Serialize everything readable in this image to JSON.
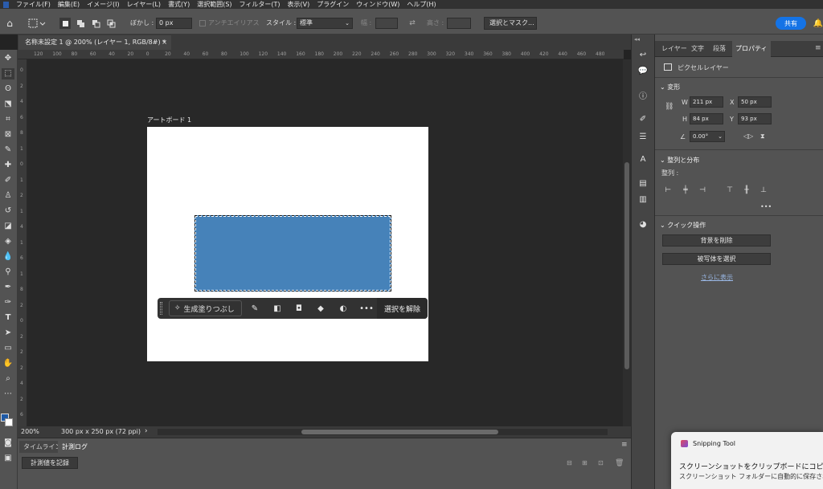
{
  "menubar": {
    "items": [
      "ファイル(F)",
      "編集(E)",
      "イメージ(I)",
      "レイヤー(L)",
      "書式(Y)",
      "選択範囲(S)",
      "フィルター(T)",
      "表示(V)",
      "プラグイン",
      "ウィンドウ(W)",
      "ヘルプ(H)"
    ]
  },
  "options": {
    "feather_label": "ぼかし :",
    "feather_value": "0 px",
    "antialias_label": "アンチエイリアス",
    "style_label": "スタイル :",
    "style_value": "標準",
    "width_label": "幅 :",
    "height_label": "高さ :",
    "select_mask_label": "選択とマスク...",
    "share_label": "共有"
  },
  "document": {
    "tab_title": "名称未設定 1 @ 200% (レイヤー 1, RGB/8#) *",
    "artboard_label": "アートボード 1",
    "zoom": "200%",
    "doc_info": "300 px x 250 px (72 ppi)"
  },
  "ruler": {
    "h_ticks": [
      "120",
      "100",
      "80",
      "60",
      "40",
      "20",
      "0",
      "20",
      "40",
      "60",
      "80",
      "100",
      "120",
      "140",
      "160",
      "180",
      "200",
      "220",
      "240",
      "260",
      "280",
      "300",
      "320",
      "340",
      "360",
      "380",
      "400",
      "420",
      "440",
      "460",
      "480"
    ],
    "v_ticks": [
      "0",
      "2",
      "4",
      "6",
      "8",
      "1",
      "0",
      "1",
      "2",
      "1",
      "4",
      "1",
      "6",
      "1",
      "8",
      "2",
      "0",
      "2",
      "2",
      "2",
      "4",
      "2",
      "6"
    ]
  },
  "contextbar": {
    "generative_fill": "生成塗りつぶし",
    "deselect": "選択を解除",
    "more": "•••"
  },
  "bottom": {
    "tabs": [
      "タイムライン",
      "計測ログ"
    ],
    "record_button": "計測値を記録"
  },
  "panel": {
    "tabs": [
      "レイヤー",
      "文字",
      "段落",
      "プロパティ"
    ],
    "active_tab": "プロパティ",
    "pixel_layer": "ピクセルレイヤー",
    "transform_title": "変形",
    "w_label": "W",
    "w_value": "211 px",
    "h_label": "H",
    "h_value": "84 px",
    "x_label": "X",
    "x_value": "50 px",
    "y_label": "Y",
    "y_value": "93 px",
    "angle_value": "0.00°",
    "align_title": "整列と分布",
    "align_label": "整列 :",
    "more": "•••",
    "quick_title": "クイック操作",
    "remove_bg": "背景を削除",
    "select_subject": "被写体を選択",
    "show_more": "さらに表示"
  },
  "toast": {
    "app": "Snipping Tool",
    "line1": "スクリーンショットをクリップボードにコピーしました",
    "line2": "スクリーンショット フォルダーに自動的に保存され"
  },
  "colors": {
    "accent": "#1473e6",
    "shape_fill": "#4682b9",
    "foreground_swatch": "#1f5aa6",
    "background_swatch": "#ffffff"
  }
}
